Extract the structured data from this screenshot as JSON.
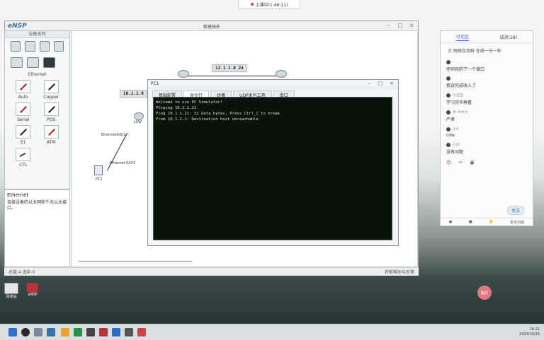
{
  "toast": {
    "text": "上课中(1:46:11)"
  },
  "ensp": {
    "logo": "eNSP",
    "title": "新建拓扑",
    "device_panel_title": "设备系列",
    "cable_category": "Ethernet",
    "cables": [
      "Auto",
      "Copper",
      "Serial",
      "POS",
      "E1",
      "ATM",
      "CTL"
    ],
    "info": {
      "title": "Ethernet",
      "text": "连接设备的以太网和千兆以太接口。"
    },
    "status_left": "总数:4 选中:0",
    "status_right": "获取帮助与反馈"
  },
  "topology": {
    "net_top": "12.1.1.0 24",
    "net_left": "10.1.1.0",
    "router_label": "LSW",
    "link_labels": [
      "Ethernet0/0/1",
      "Ethernet 0/0/1"
    ],
    "pc_label": "PC1"
  },
  "pc1": {
    "title": "PC1",
    "tabs": [
      "基础配置",
      "命令行",
      "组播",
      "UDP发包工具",
      "串口"
    ],
    "terminal_lines": [
      "Welcome to use PC Simulator!",
      "",
      "PC>ping 10.1.1.21",
      "",
      "Ping 10.1.1.21: 32 data bytes, Press Ctrl_C to break",
      "From 10.1.1.1: Destination host unreachable"
    ]
  },
  "chat": {
    "tabs": [
      "讨论区",
      "成员(28)"
    ],
    "notice": "大 网络交流群 在线一分一秒",
    "messages": [
      {
        "user": "",
        "text": "老师我的下一个接口"
      },
      {
        "user": "",
        "text": "我设完成收入了"
      },
      {
        "user": "小宝宝",
        "text": "学习完毕再看"
      },
      {
        "user": "木 木大大",
        "text": "严肃"
      },
      {
        "user": "小A",
        "text": "cow"
      },
      {
        "user": "小白",
        "text": "没有问题"
      }
    ],
    "send_label": "发送",
    "footer": [
      "",
      "",
      "",
      "更多功能"
    ]
  },
  "desktop": {
    "icons": [
      "回收站",
      "eNSP"
    ],
    "circle_button": "提问"
  },
  "taskbar": {
    "time": "16:21",
    "date": "2023/10/26"
  }
}
